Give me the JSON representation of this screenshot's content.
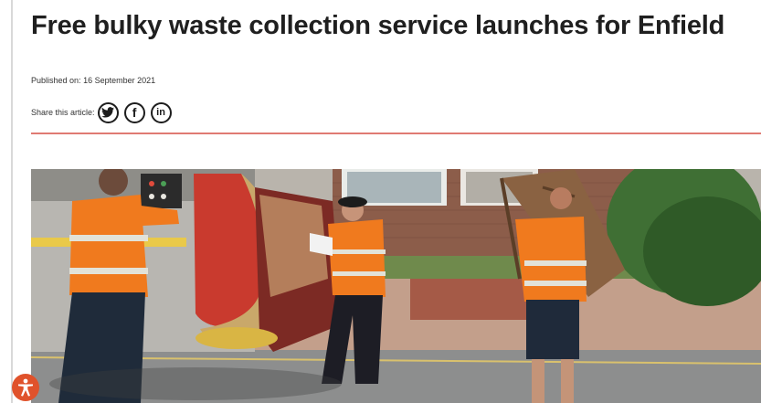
{
  "article": {
    "title": "Free bulky waste collection service launches for Enfield",
    "published_label": "Published on:",
    "published_date": "16 September 2021",
    "share_label": "Share this article:",
    "share_buttons": [
      {
        "icon": "twitter-icon",
        "network": "Twitter"
      },
      {
        "icon": "facebook-icon",
        "network": "Facebook"
      },
      {
        "icon": "linkedin-icon",
        "network": "LinkedIn"
      }
    ],
    "share_glyphs": {
      "facebook": "f",
      "linkedin": "in"
    }
  },
  "colors": {
    "divider": "#e07a73",
    "hi_vis_orange": "#f07a1e",
    "accessibility_button": "#e0522b"
  }
}
